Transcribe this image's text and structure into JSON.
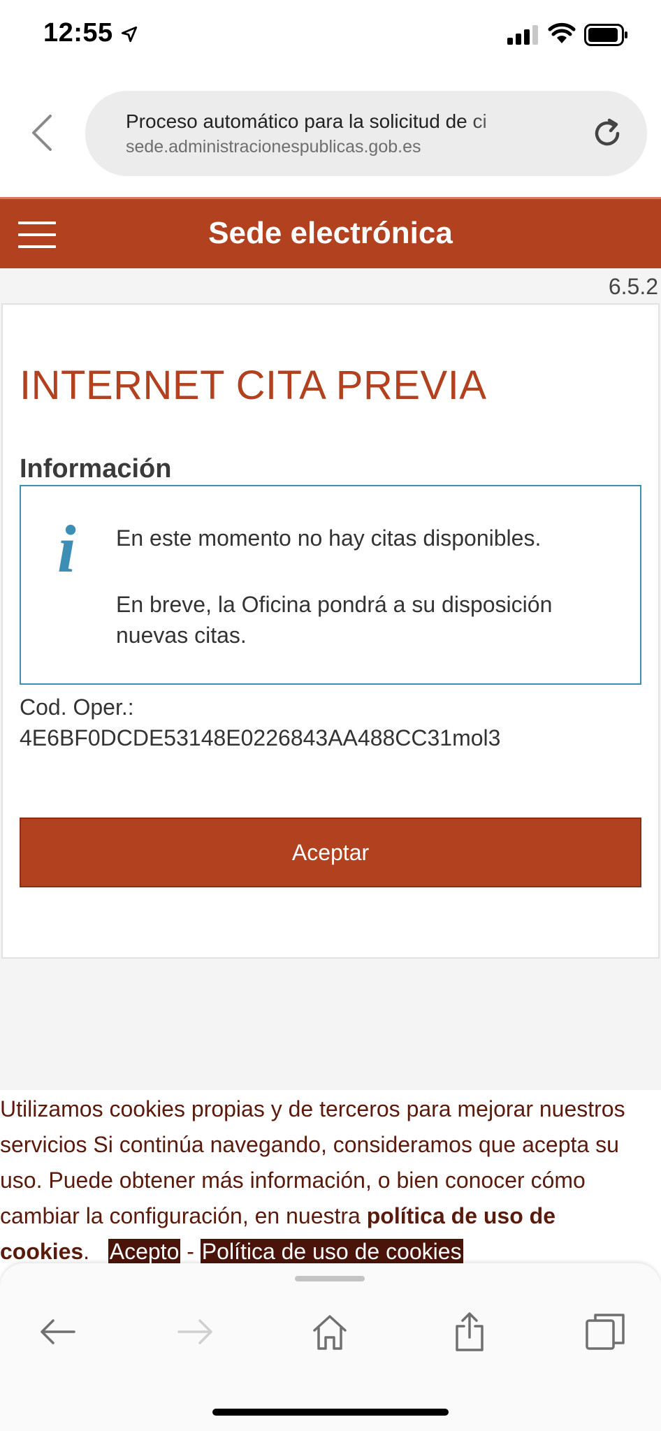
{
  "status_bar": {
    "time": "12:55",
    "icons": [
      "location-arrow-icon",
      "cellular-signal-icon",
      "wifi-icon",
      "battery-icon"
    ]
  },
  "browser": {
    "page_title": "Proceso automático para la solicitud de ci",
    "domain": "sede.administracionespublicas.gob.es",
    "icons": [
      "back-chevron-icon",
      "reload-icon"
    ]
  },
  "header": {
    "title": "Sede electrónica",
    "menu_icon": "hamburger-icon",
    "color": "#b1411f"
  },
  "version": "6.5.2",
  "main": {
    "title": "INTERNET CITA PREVIA",
    "info_heading": "Información",
    "info_icon": "info-icon",
    "info_glyph": "i",
    "info_line1": "En este momento no hay citas disponibles.",
    "info_line2": "En breve, la Oficina pondrá a su disposición nuevas citas.",
    "cod_label": "Cod. Oper.:",
    "cod_value": "4E6BF0DCDE53148E0226843AA488CC31mol3",
    "accept_label": "Aceptar",
    "accent_color": "#b1411f",
    "info_color": "#3d8eb5"
  },
  "cookies": {
    "text": "Utilizamos cookies propias y de terceros para mejorar nuestros servicios Si continúa navegando, consideramos que acepta su uso. Puede obtener más información, o bien conocer cómo cambiar la configuración, en nuestra",
    "policy_bold": "política de uso de cookies",
    "period": ".",
    "accept_link": "Acepto",
    "separator": "-",
    "policy_link": "Política de uso de cookies",
    "text_color": "#5a1a0c"
  },
  "toolbar": {
    "icons": [
      "back-arrow-icon",
      "forward-arrow-icon",
      "home-icon",
      "share-icon",
      "tabs-icon"
    ]
  }
}
